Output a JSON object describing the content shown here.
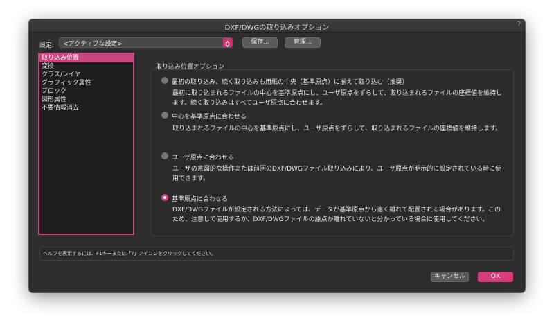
{
  "window": {
    "title": "DXF/DWGの取り込みオプション",
    "help_glyph": "?"
  },
  "settings": {
    "label": "設定:",
    "selected": "<アクティブな設定>",
    "save_label": "保存...",
    "manage_label": "管理..."
  },
  "categories": {
    "items": [
      {
        "label": "取り込み位置",
        "selected": true
      },
      {
        "label": "変換",
        "selected": false
      },
      {
        "label": "クラス/レイヤ",
        "selected": false
      },
      {
        "label": "グラフィック属性",
        "selected": false
      },
      {
        "label": "ブロック",
        "selected": false
      },
      {
        "label": "図形属性",
        "selected": false
      },
      {
        "label": "不要情報消去",
        "selected": false
      }
    ]
  },
  "position_options": {
    "group_label": "取り込み位置オプション",
    "options": [
      {
        "label": "最初の取り込み、続く取り込みも用紙の中央（基準原点）に揃えて取り込む（推奨）",
        "checked": false,
        "desc": [
          "最初に取り込まれるファイルの中心を基準原点にし、ユーザ原点をずらして、取り込まれるファイルの座標値を維持し",
          "ます。続く取り込みはすべてユーザ原点に合わせます。"
        ]
      },
      {
        "label": "中心を基準原点に合わせる",
        "checked": false,
        "desc": [
          "取り込まれるファイルの中心を基準原点にし、ユーザ原点をずらして、取り込まれるファイルの座標値を維持します。"
        ]
      },
      {
        "label": "ユーザ原点に合わせる",
        "checked": false,
        "desc": [
          "ユーザの意図的な操作または前回のDXF/DWGファイル取り込みにより、ユーザ原点が明示的に設定されている時に使",
          "用できます。"
        ]
      },
      {
        "label": "基準原点に合わせる",
        "checked": true,
        "desc": [
          "DXF/DWGファイルが設定される方法によっては、データが基準原点から遠く離れて配置される場合があります。この",
          "ため、注意して使用するか、DXF/DWGファイルの原点が離れていないと分かっている場合に使用してください。"
        ]
      }
    ]
  },
  "help_bar": {
    "text": "ヘルプを表示するには、F1キーまたは「?」アイコンをクリックしてください。"
  },
  "buttons": {
    "cancel_label": "キャンセル",
    "ok_label": "OK"
  },
  "colors": {
    "accent": "#d8407d",
    "dialog_bg": "#2d2d2d",
    "list_bg": "#1e1e1e"
  }
}
